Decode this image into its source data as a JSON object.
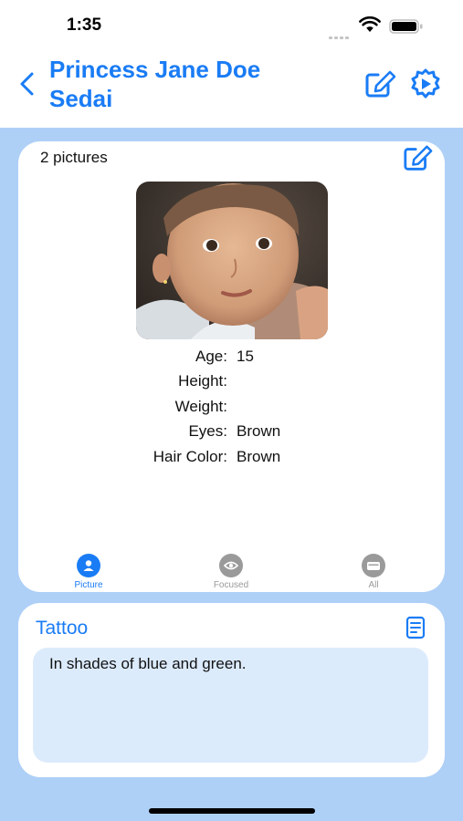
{
  "status": {
    "time": "1:35"
  },
  "nav": {
    "title": "Princess Jane Doe Sedai"
  },
  "profile": {
    "picture_count": "2 pictures",
    "details": [
      {
        "label": "Age:",
        "value": "15"
      },
      {
        "label": "Height:",
        "value": ""
      },
      {
        "label": "Weight:",
        "value": ""
      },
      {
        "label": "Eyes:",
        "value": "Brown"
      },
      {
        "label": "Hair Color:",
        "value": "Brown"
      }
    ]
  },
  "tabs": [
    {
      "label": "Picture",
      "icon": "person-circle-icon",
      "active": true
    },
    {
      "label": "Focused",
      "icon": "eye-circle-icon",
      "active": false
    },
    {
      "label": "All",
      "icon": "cards-circle-icon",
      "active": false
    }
  ],
  "tattoo": {
    "title": "Tattoo",
    "text": "In shades of blue and green."
  },
  "colors": {
    "accent": "#1a7cf5",
    "background": "#aed0f7",
    "tab_inactive": "#9a9a9a",
    "tattoo_box": "#dcebfc"
  }
}
